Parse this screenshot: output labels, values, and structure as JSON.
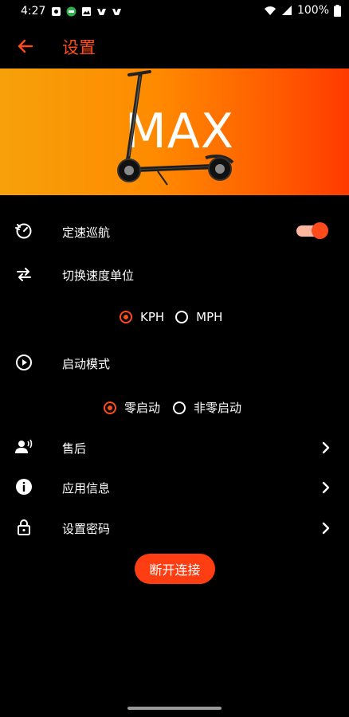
{
  "status_bar": {
    "time": "4:27",
    "battery": "100%"
  },
  "app_bar": {
    "title": "设置"
  },
  "banner": {
    "model": "MAX"
  },
  "settings": {
    "cruise": {
      "label": "定速巡航",
      "enabled": true
    },
    "speed_unit": {
      "label": "切换速度单位",
      "options": [
        "KPH",
        "MPH"
      ],
      "selected": "KPH"
    },
    "start_mode": {
      "label": "启动模式",
      "options": [
        "零启动",
        "非零启动"
      ],
      "selected": "零启动"
    },
    "after_sales": {
      "label": "售后"
    },
    "app_info": {
      "label": "应用信息"
    },
    "password": {
      "label": "设置密码"
    }
  },
  "actions": {
    "disconnect": "断开连接"
  },
  "colors": {
    "accent": "#ff4a1c",
    "background": "#000000",
    "banner_start": "#f6a10a",
    "banner_end": "#ff3a00"
  }
}
